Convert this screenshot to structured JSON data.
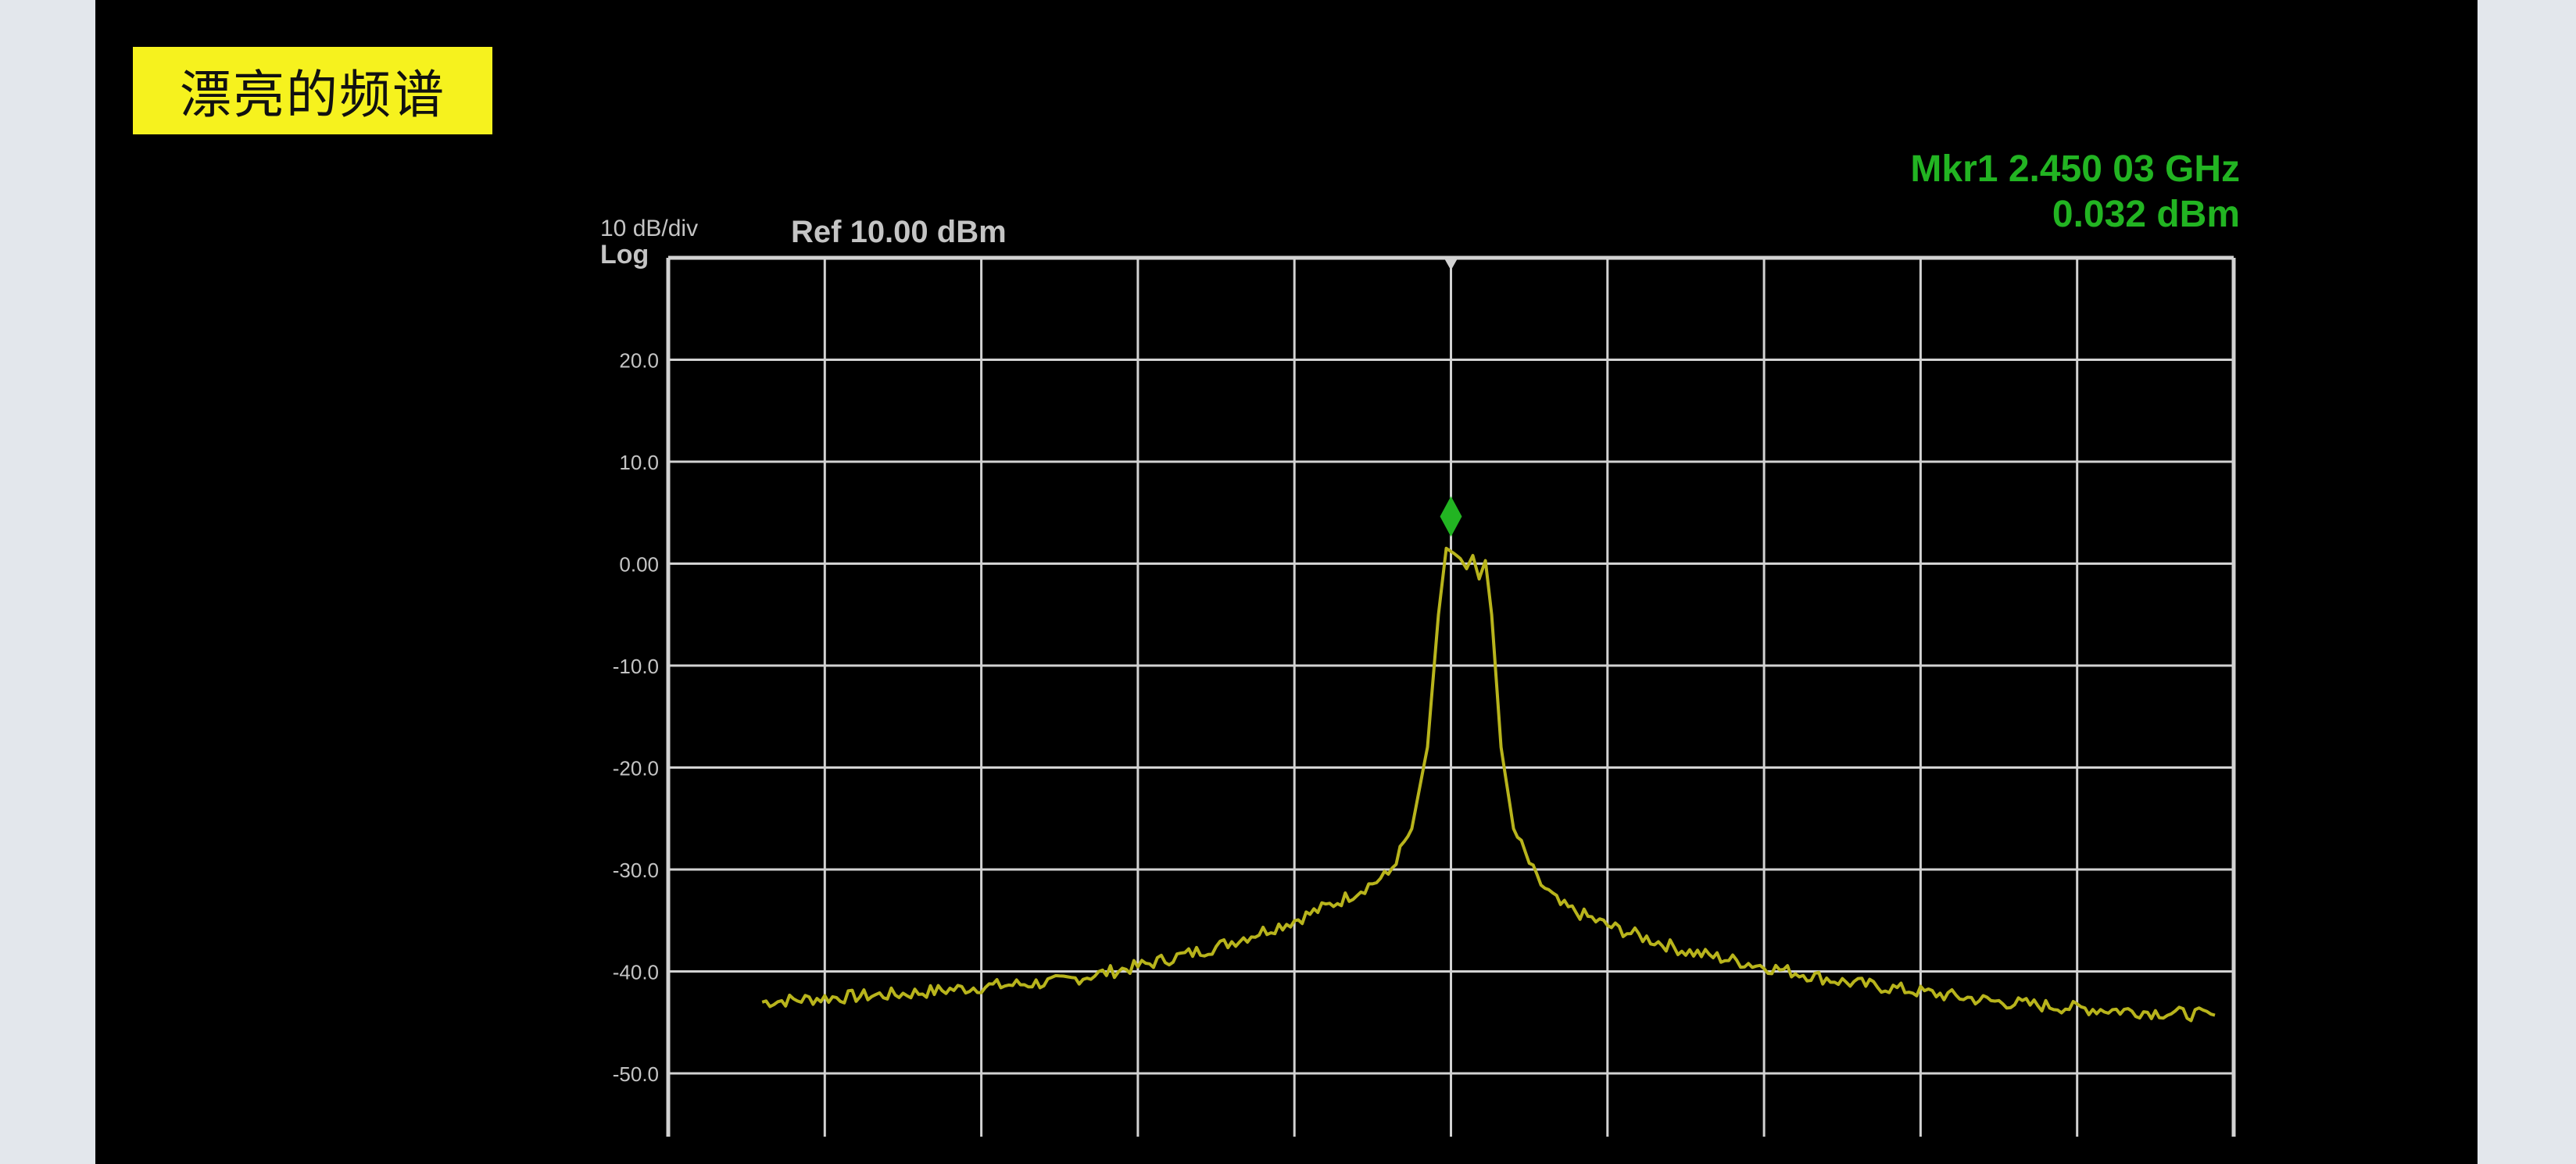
{
  "title_badge": "漂亮的频谱",
  "instrument": {
    "scale_label": "10 dB/div",
    "scale_type": "Log",
    "ref_level": "Ref 10.00 dBm"
  },
  "marker": {
    "freq_readout": "Mkr1 2.450 03 GHz",
    "amp_readout": "0.032 dBm",
    "color": "#22b422"
  },
  "colors": {
    "trace": "#b8b41c",
    "grid": "#d2d2d2",
    "label": "#c4c4c4",
    "badge": "#f6f21e",
    "marker": "#22b422"
  },
  "chart_data": {
    "type": "line",
    "title": "漂亮的频谱",
    "xlabel": "",
    "ylabel": "",
    "ylim": [
      -55,
      10
    ],
    "y_ticks": [
      "20.0",
      "10.0",
      "0.00",
      "-10.0",
      "-20.0",
      "-30.0",
      "-40.0",
      "-50.0"
    ],
    "x_divisions": 10,
    "grid": true,
    "marker": {
      "x": 5.0,
      "y": 0.032
    },
    "series": [
      {
        "x": [
          0.6,
          1.0,
          1.5,
          2.0,
          2.5,
          3.0,
          3.5,
          4.0,
          4.3,
          4.6,
          4.75,
          4.85,
          4.92,
          4.97,
          5.02,
          5.06,
          5.1,
          5.14,
          5.18,
          5.22,
          5.26,
          5.32,
          5.4,
          5.55,
          5.7,
          6.0,
          6.5,
          7.0,
          7.5,
          8.0,
          8.5,
          9.0,
          9.5,
          9.88
        ],
        "y": [
          -43.0,
          -42.6,
          -42.2,
          -41.5,
          -41.0,
          -39.5,
          -37.6,
          -35.0,
          -33.0,
          -30.5,
          -26.0,
          -18.0,
          -5.0,
          1.5,
          1.0,
          0.5,
          -0.5,
          0.8,
          -1.5,
          0.3,
          -5.0,
          -18.0,
          -26.0,
          -31.0,
          -33.5,
          -35.5,
          -38.0,
          -39.5,
          -41.0,
          -42.0,
          -43.0,
          -43.6,
          -44.0,
          -44.3
        ]
      }
    ]
  }
}
